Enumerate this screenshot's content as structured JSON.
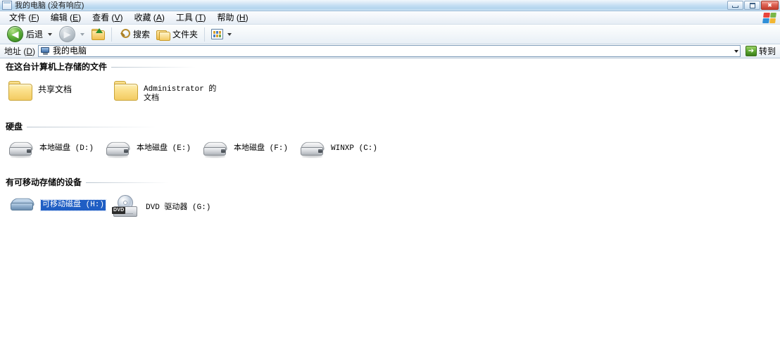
{
  "window": {
    "title": "我的电脑 (没有响应)",
    "title_icon": "window-icon",
    "buttons": {
      "minimize": "minimize",
      "maximize": "maximize",
      "close": "✖"
    }
  },
  "menubar": {
    "items": [
      {
        "label": "文件",
        "accel": "F"
      },
      {
        "label": "编辑",
        "accel": "E"
      },
      {
        "label": "查看",
        "accel": "V"
      },
      {
        "label": "收藏",
        "accel": "A"
      },
      {
        "label": "工具",
        "accel": "T"
      },
      {
        "label": "帮助",
        "accel": "H"
      }
    ]
  },
  "toolbar": {
    "back_label": "后退",
    "back_glyph": "◀",
    "forward_glyph": "▶",
    "up_label": "",
    "search_label": "搜索",
    "folders_label": "文件夹",
    "views_label": ""
  },
  "address": {
    "label": "地址",
    "label_accel": "D",
    "value": "我的电脑",
    "go_label": "转到",
    "go_glyph": "➔"
  },
  "groups": [
    {
      "title": "在这台计算机上存储的文件",
      "items": [
        {
          "name": "共享文档",
          "icon": "folder-icon",
          "script": "cjk",
          "selected": false
        },
        {
          "name": "Administrator 的文档",
          "icon": "folder-icon",
          "script": "mono",
          "selected": false
        }
      ]
    },
    {
      "title": "硬盘",
      "items": [
        {
          "name": "本地磁盘 (D:)",
          "icon": "hard-disk-icon",
          "script": "mono",
          "selected": false
        },
        {
          "name": "本地磁盘 (E:)",
          "icon": "hard-disk-icon",
          "script": "mono",
          "selected": false
        },
        {
          "name": "本地磁盘 (F:)",
          "icon": "hard-disk-icon",
          "script": "mono",
          "selected": false
        },
        {
          "name": "WINXP (C:)",
          "icon": "hard-disk-icon",
          "script": "mono",
          "selected": false
        }
      ]
    },
    {
      "title": "有可移动存储的设备",
      "items": [
        {
          "name": "可移动磁盘 (H:)",
          "icon": "removable-disk-icon",
          "script": "mono",
          "selected": true
        },
        {
          "name": "DVD 驱动器 (G:)",
          "icon": "dvd-drive-icon",
          "script": "mono",
          "selected": false,
          "badge": "DVD"
        }
      ]
    }
  ],
  "colors": {
    "selection": "#1f5ec4",
    "titlebar": "#c2ddf2",
    "close_button": "#c33c2c"
  }
}
